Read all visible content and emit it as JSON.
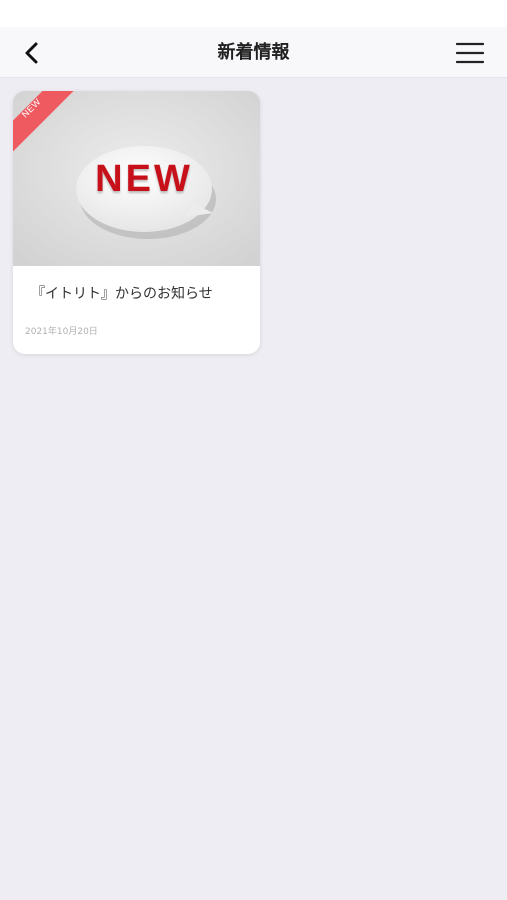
{
  "header": {
    "title": "新着情報",
    "back_icon": "chevron-left-icon",
    "menu_icon": "hamburger-menu-icon"
  },
  "news": [
    {
      "badge": "NEW",
      "image_text": "NEW",
      "title": "『イトリト』からのお知らせ",
      "date": "2021年10月20日"
    }
  ],
  "colors": {
    "background": "#eeedf3",
    "header": "#f8f8fa",
    "badge": "#ee5a5f",
    "image_text": "#c8101a"
  }
}
